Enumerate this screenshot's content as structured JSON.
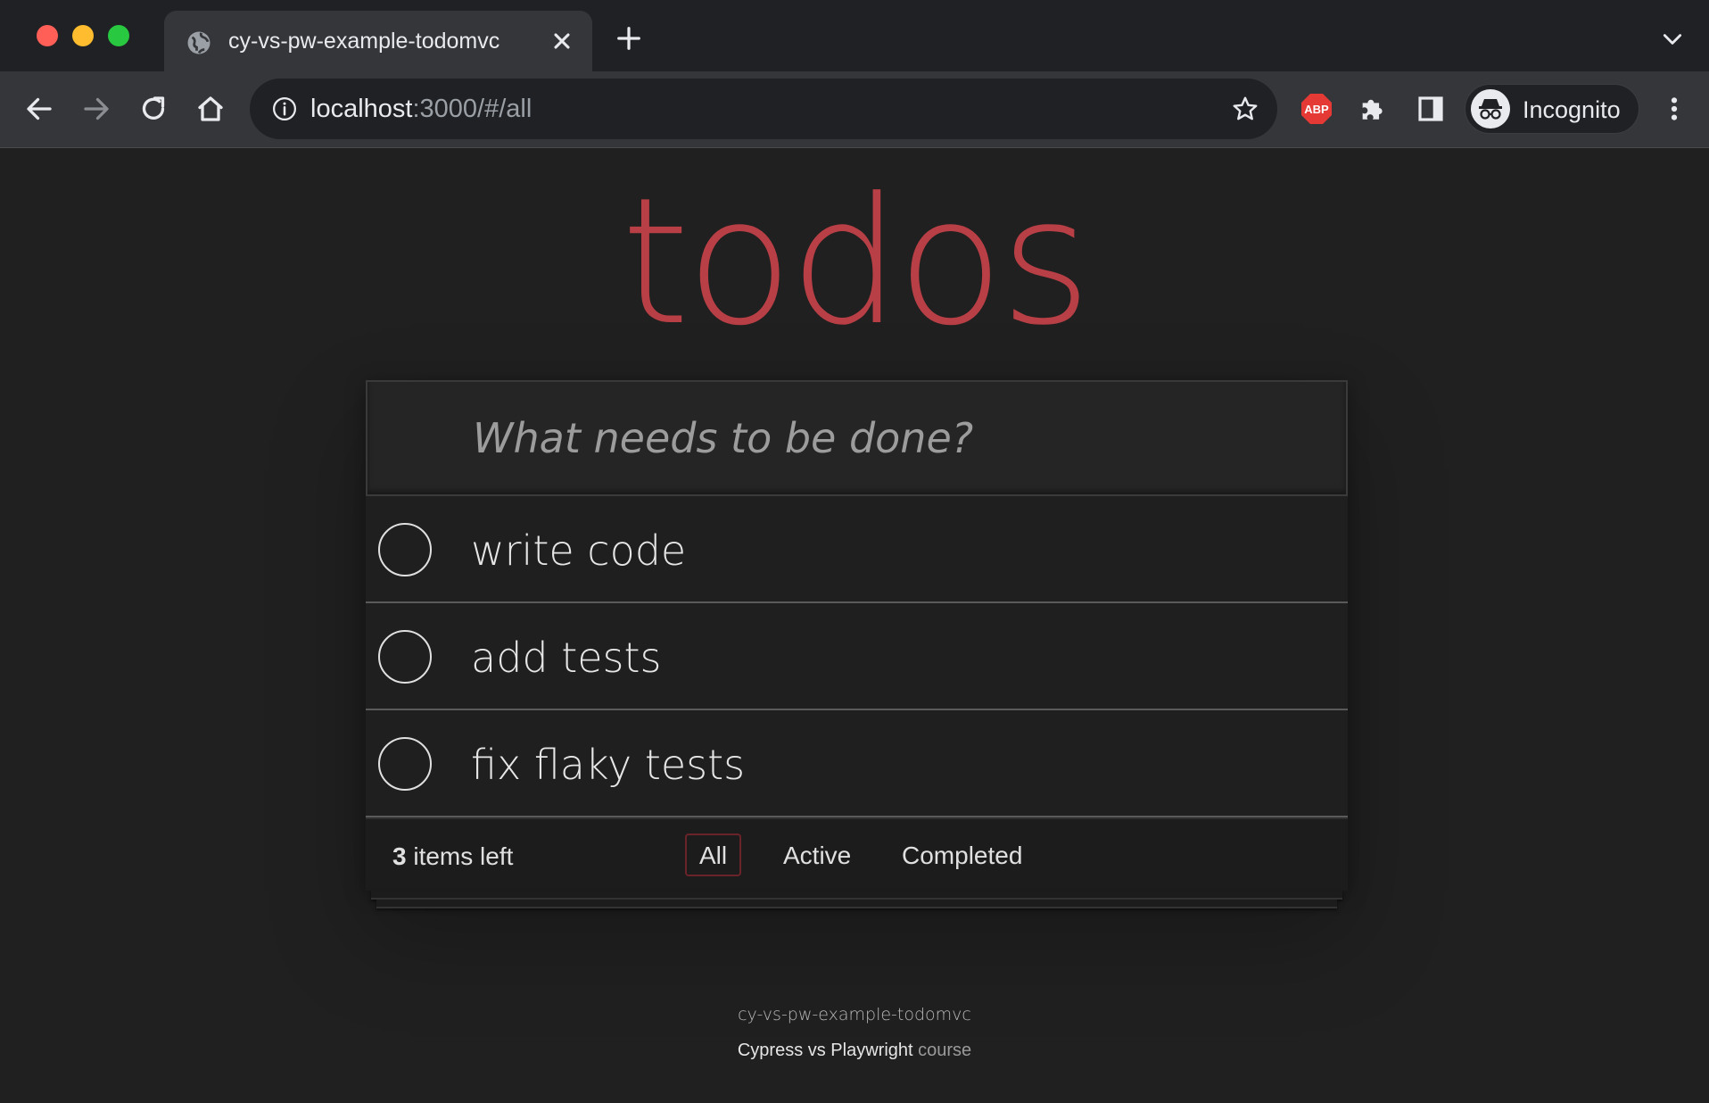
{
  "browser": {
    "tab": {
      "title": "cy-vs-pw-example-todomvc",
      "icon": "globe-icon"
    },
    "address": {
      "host": "localhost",
      "rest": ":3000/#/all"
    },
    "profile": {
      "label": "Incognito"
    },
    "extensions": {
      "abp_label": "ABP"
    }
  },
  "app": {
    "title": "todos",
    "new_todo_placeholder": "What needs to be done?",
    "todos": [
      {
        "title": "write code",
        "completed": false
      },
      {
        "title": "add tests",
        "completed": false
      },
      {
        "title": "fix flaky tests",
        "completed": false
      }
    ],
    "footer": {
      "count": "3",
      "count_suffix": " items left",
      "filters": [
        "All",
        "Active",
        "Completed"
      ],
      "selected_filter": "All"
    },
    "info": {
      "line1": "cy-vs-pw-example-todomvc",
      "line2_main": "Cypress vs Playwright",
      "line2_muted": "course"
    }
  },
  "colors": {
    "accent": "#b83f45",
    "background": "#202020",
    "selected_filter_border": "#6a2328"
  }
}
